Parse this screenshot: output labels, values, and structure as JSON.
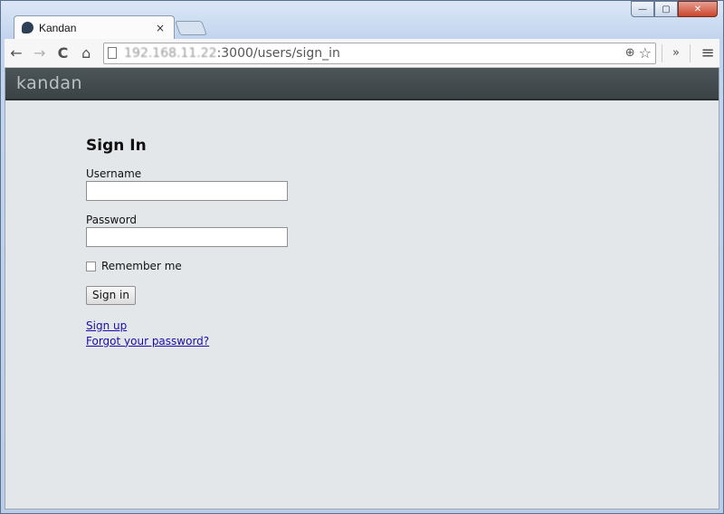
{
  "browser": {
    "tab": {
      "title": "Kandan",
      "close": "×"
    },
    "window_controls": {
      "minimize": "—",
      "maximize": "▢",
      "close": "✕"
    },
    "toolbar": {
      "back": "←",
      "forward": "→",
      "reload": "C",
      "home": "⌂",
      "url_host": "192.168.11.22",
      "url_path": ":3000/users/sign_in",
      "zoom": "⊕",
      "star": "☆",
      "extensions": "»",
      "menu": "≡"
    }
  },
  "app": {
    "logo": "kandan"
  },
  "form": {
    "title": "Sign In",
    "username_label": "Username",
    "password_label": "Password",
    "remember_label": "Remember me",
    "submit_label": "Sign in",
    "signup_link": "Sign up",
    "forgot_link": "Forgot your password?"
  }
}
